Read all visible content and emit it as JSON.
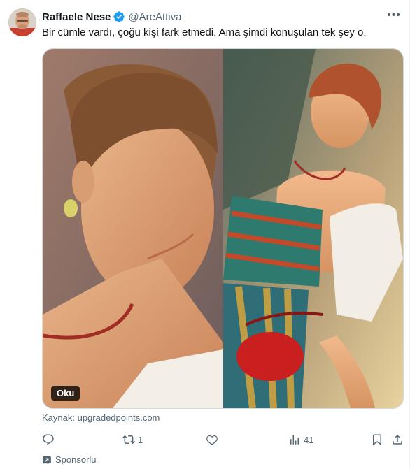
{
  "author": {
    "name": "Raffaele Nese",
    "handle": "@AreAttiva",
    "verified": true
  },
  "tweet": {
    "text": "Bir cümle vardı, çoğu kişi fark etmedi. Ama şimdi konuşulan tek şey o."
  },
  "media": {
    "badge_label": "Oku"
  },
  "source": "Kaynak: upgradedpoints.com",
  "actions": {
    "reply_count": "",
    "retweet_count": "1",
    "like_count": "",
    "views_count": "41"
  },
  "promoted_label": "Sponsorlu",
  "colors": {
    "verified_blue": "#1d9bf0",
    "secondary_text": "#536471"
  }
}
